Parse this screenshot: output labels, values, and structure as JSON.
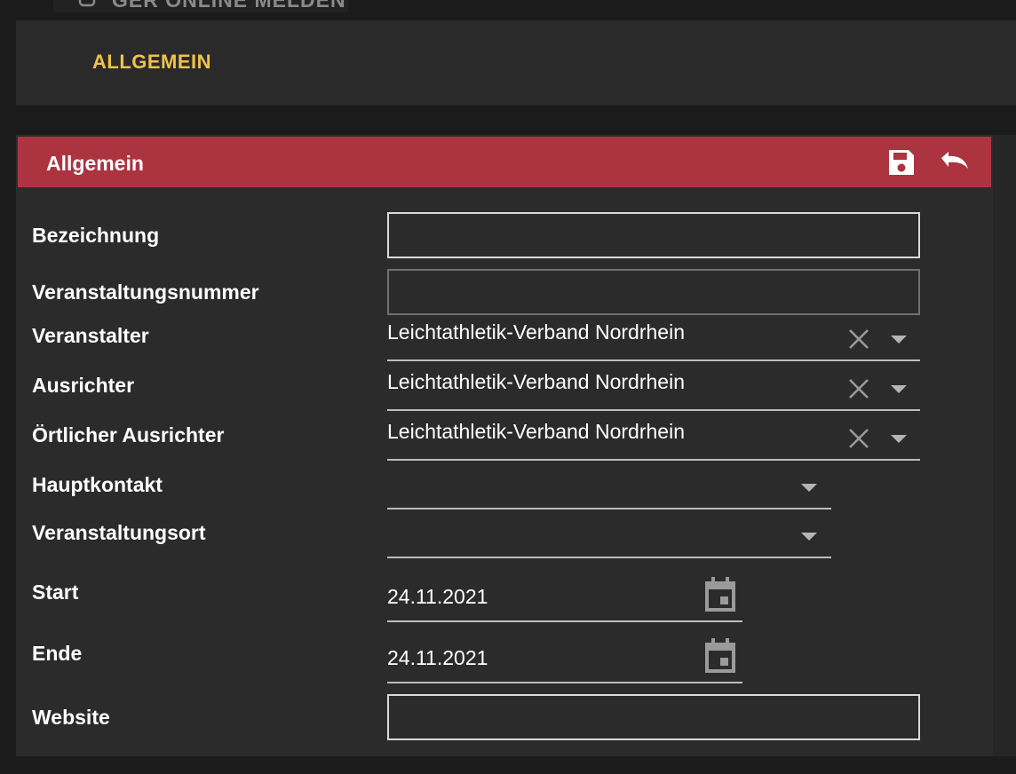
{
  "top": {
    "cut_text": "GER ONLINE MELDEN"
  },
  "tabs": [
    {
      "label": "ALLGEMEIN",
      "active": true
    }
  ],
  "panel": {
    "title": "Allgemein",
    "actions": {
      "save_icon": "save-icon",
      "undo_icon": "undo-icon"
    }
  },
  "fields": {
    "bezeichnung": {
      "label": "Bezeichnung",
      "value": ""
    },
    "veranstaltungsnummer": {
      "label": "Veranstaltungsnummer",
      "value": ""
    },
    "veranstalter": {
      "label": "Veranstalter",
      "value": "Leichtathletik-Verband Nordrhein"
    },
    "ausrichter": {
      "label": "Ausrichter",
      "value": "Leichtathletik-Verband Nordrhein"
    },
    "oertlicher_ausrichter": {
      "label": "Örtlicher Ausrichter",
      "value": "Leichtathletik-Verband Nordrhein"
    },
    "hauptkontakt": {
      "label": "Hauptkontakt",
      "value": ""
    },
    "veranstaltungsort": {
      "label": "Veranstaltungsort",
      "value": ""
    },
    "start": {
      "label": "Start",
      "value": "24.11.2021"
    },
    "ende": {
      "label": "Ende",
      "value": "24.11.2021"
    },
    "website": {
      "label": "Website",
      "value": ""
    }
  },
  "colors": {
    "accent_tab": "#f0c24a",
    "header_red": "#ac3441",
    "panel_bg": "#2b2b2b",
    "page_bg": "#1b1b1b"
  }
}
